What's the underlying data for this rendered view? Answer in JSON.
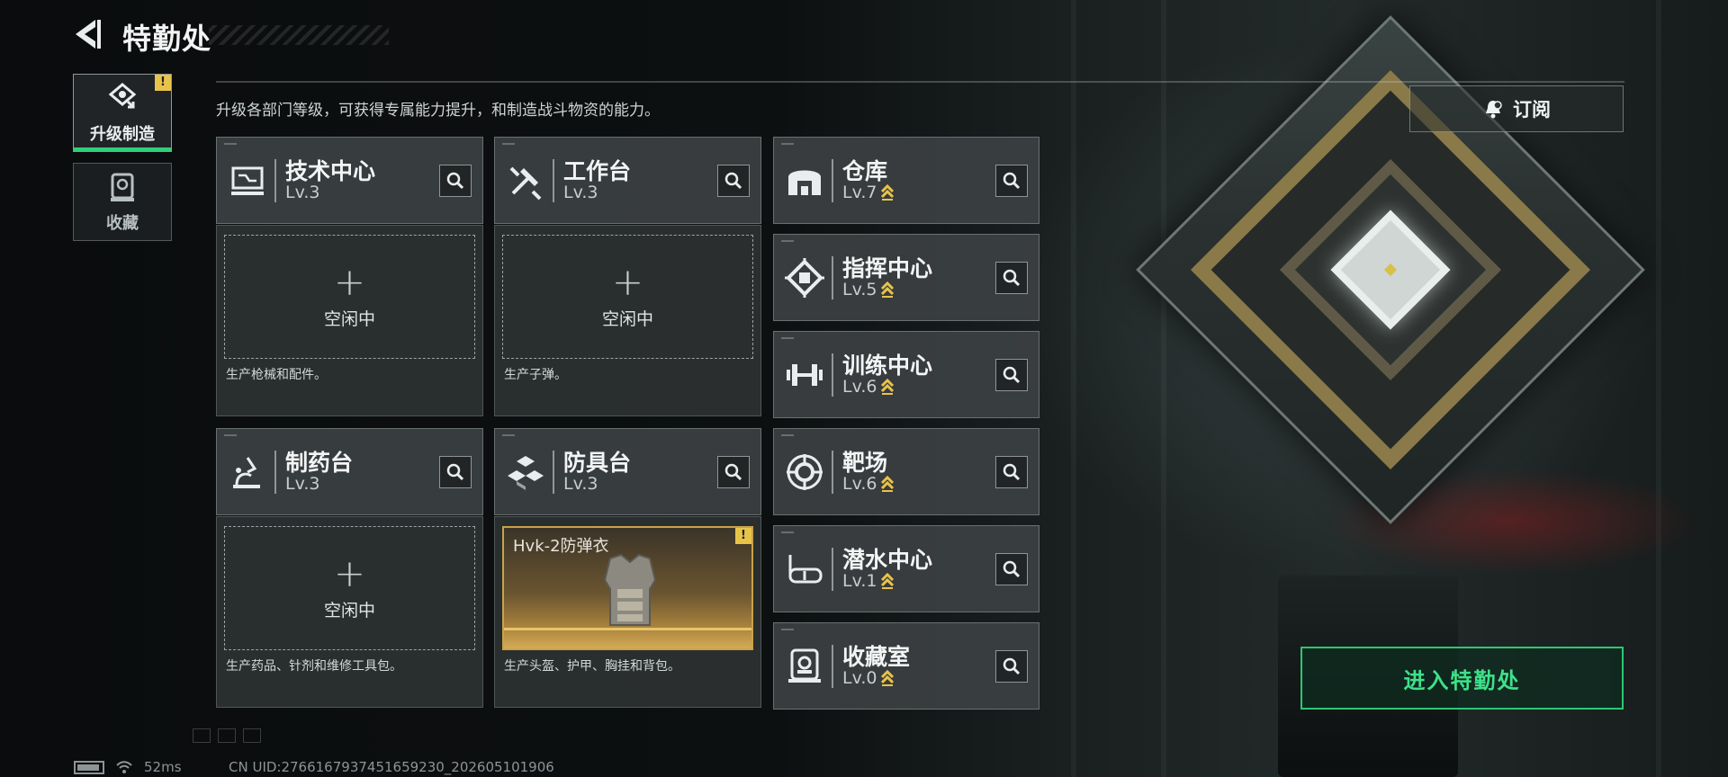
{
  "header": {
    "title": "特勤处",
    "description": "升级各部门等级，可获得专属能力提升，和制造战斗物资的能力。"
  },
  "sidebar": {
    "tabs": [
      {
        "label": "升级制造",
        "active": true,
        "warning": "!"
      },
      {
        "label": "收藏",
        "active": false
      }
    ]
  },
  "subscribe": {
    "label": "订阅"
  },
  "departments": [
    {
      "name": "技术中心",
      "level": "Lv.3",
      "icon": "tech-center-icon"
    },
    {
      "name": "工作台",
      "level": "Lv.3",
      "icon": "workbench-icon"
    },
    {
      "name": "仓库",
      "level": "Lv.7",
      "icon": "warehouse-icon",
      "upgradable": true
    },
    {
      "name": "指挥中心",
      "level": "Lv.5",
      "icon": "command-center-icon",
      "upgradable": true
    },
    {
      "name": "训练中心",
      "level": "Lv.6",
      "icon": "training-center-icon",
      "upgradable": true
    },
    {
      "name": "制药台",
      "level": "Lv.3",
      "icon": "pharmacy-icon"
    },
    {
      "name": "防具台",
      "level": "Lv.3",
      "icon": "armor-bench-icon"
    },
    {
      "name": "靶场",
      "level": "Lv.6",
      "icon": "shooting-range-icon",
      "upgradable": true
    },
    {
      "name": "潜水中心",
      "level": "Lv.1",
      "icon": "diving-center-icon",
      "upgradable": true
    },
    {
      "name": "收藏室",
      "level": "Lv.0",
      "icon": "collection-room-icon",
      "upgradable": true
    }
  ],
  "production": {
    "tech": {
      "status": "空闲中",
      "desc": "生产枪械和配件。"
    },
    "workbench": {
      "status": "空闲中",
      "desc": "生产子弹。"
    },
    "pharmacy": {
      "status": "空闲中",
      "desc": "生产药品、针剂和维修工具包。"
    },
    "armor": {
      "item": "Hvk-2防弹衣",
      "desc": "生产头盔、护甲、胸挂和背包。",
      "warning": "!"
    }
  },
  "enter_button": {
    "label": "进入特勤处"
  },
  "status_bar": {
    "ping": "52ms",
    "uid": "CN UID:2766167937451659230_202605101906"
  },
  "colors": {
    "accent_green": "#2bc873",
    "upgrade_gold": "#e8c34a",
    "card_bg": "#3c4042"
  }
}
